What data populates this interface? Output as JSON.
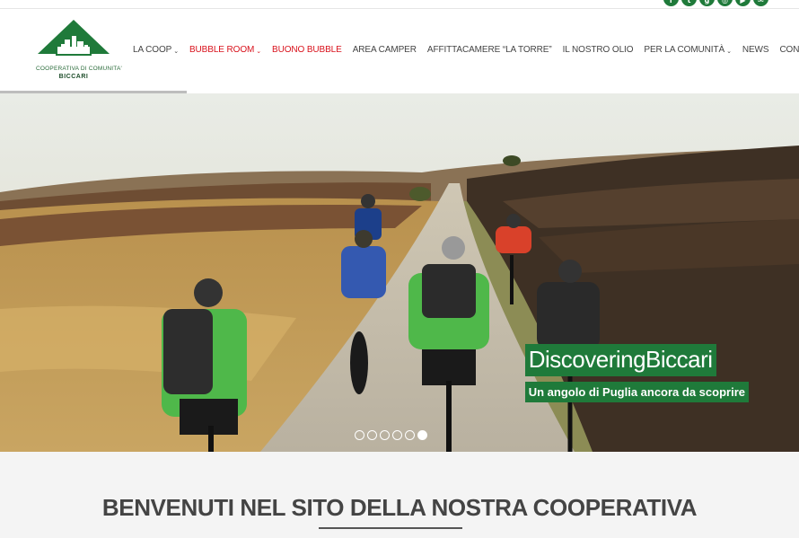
{
  "social": {
    "icons": [
      "facebook-icon",
      "twitter-icon",
      "google-plus-icon",
      "instagram-icon",
      "youtube-icon",
      "email-icon"
    ]
  },
  "logo": {
    "line1": "COOPERATIVA DI COMUNITA'",
    "line2": "BICCARI",
    "color": "#1f7a3a"
  },
  "nav": {
    "items": [
      {
        "label": "LA COOP",
        "has_dropdown": true,
        "highlight": false
      },
      {
        "label": "BUBBLE ROOM",
        "has_dropdown": true,
        "highlight": true
      },
      {
        "label": "BUONO BUBBLE",
        "has_dropdown": false,
        "highlight": true
      },
      {
        "label": "AREA CAMPER",
        "has_dropdown": false,
        "highlight": false
      },
      {
        "label": "AFFITTACAMERE “LA TORRE”",
        "has_dropdown": false,
        "highlight": false
      },
      {
        "label": "IL NOSTRO OLIO",
        "has_dropdown": false,
        "highlight": false
      },
      {
        "label": "PER LA COMUNITÀ",
        "has_dropdown": true,
        "highlight": false
      },
      {
        "label": "NEWS",
        "has_dropdown": false,
        "highlight": false
      },
      {
        "label": "CONTATTI",
        "has_dropdown": false,
        "highlight": false
      }
    ],
    "highlight_color": "#d9121c"
  },
  "hero": {
    "title": "DiscoveringBiccari",
    "subtitle": "Un angolo di Puglia ancora da scoprire",
    "slide_count": 6,
    "active_slide": 6,
    "caption_color": "#1f7a3a"
  },
  "welcome": {
    "title": "BENVENUTI NEL SITO DELLA NOSTRA COOPERATIVA"
  }
}
